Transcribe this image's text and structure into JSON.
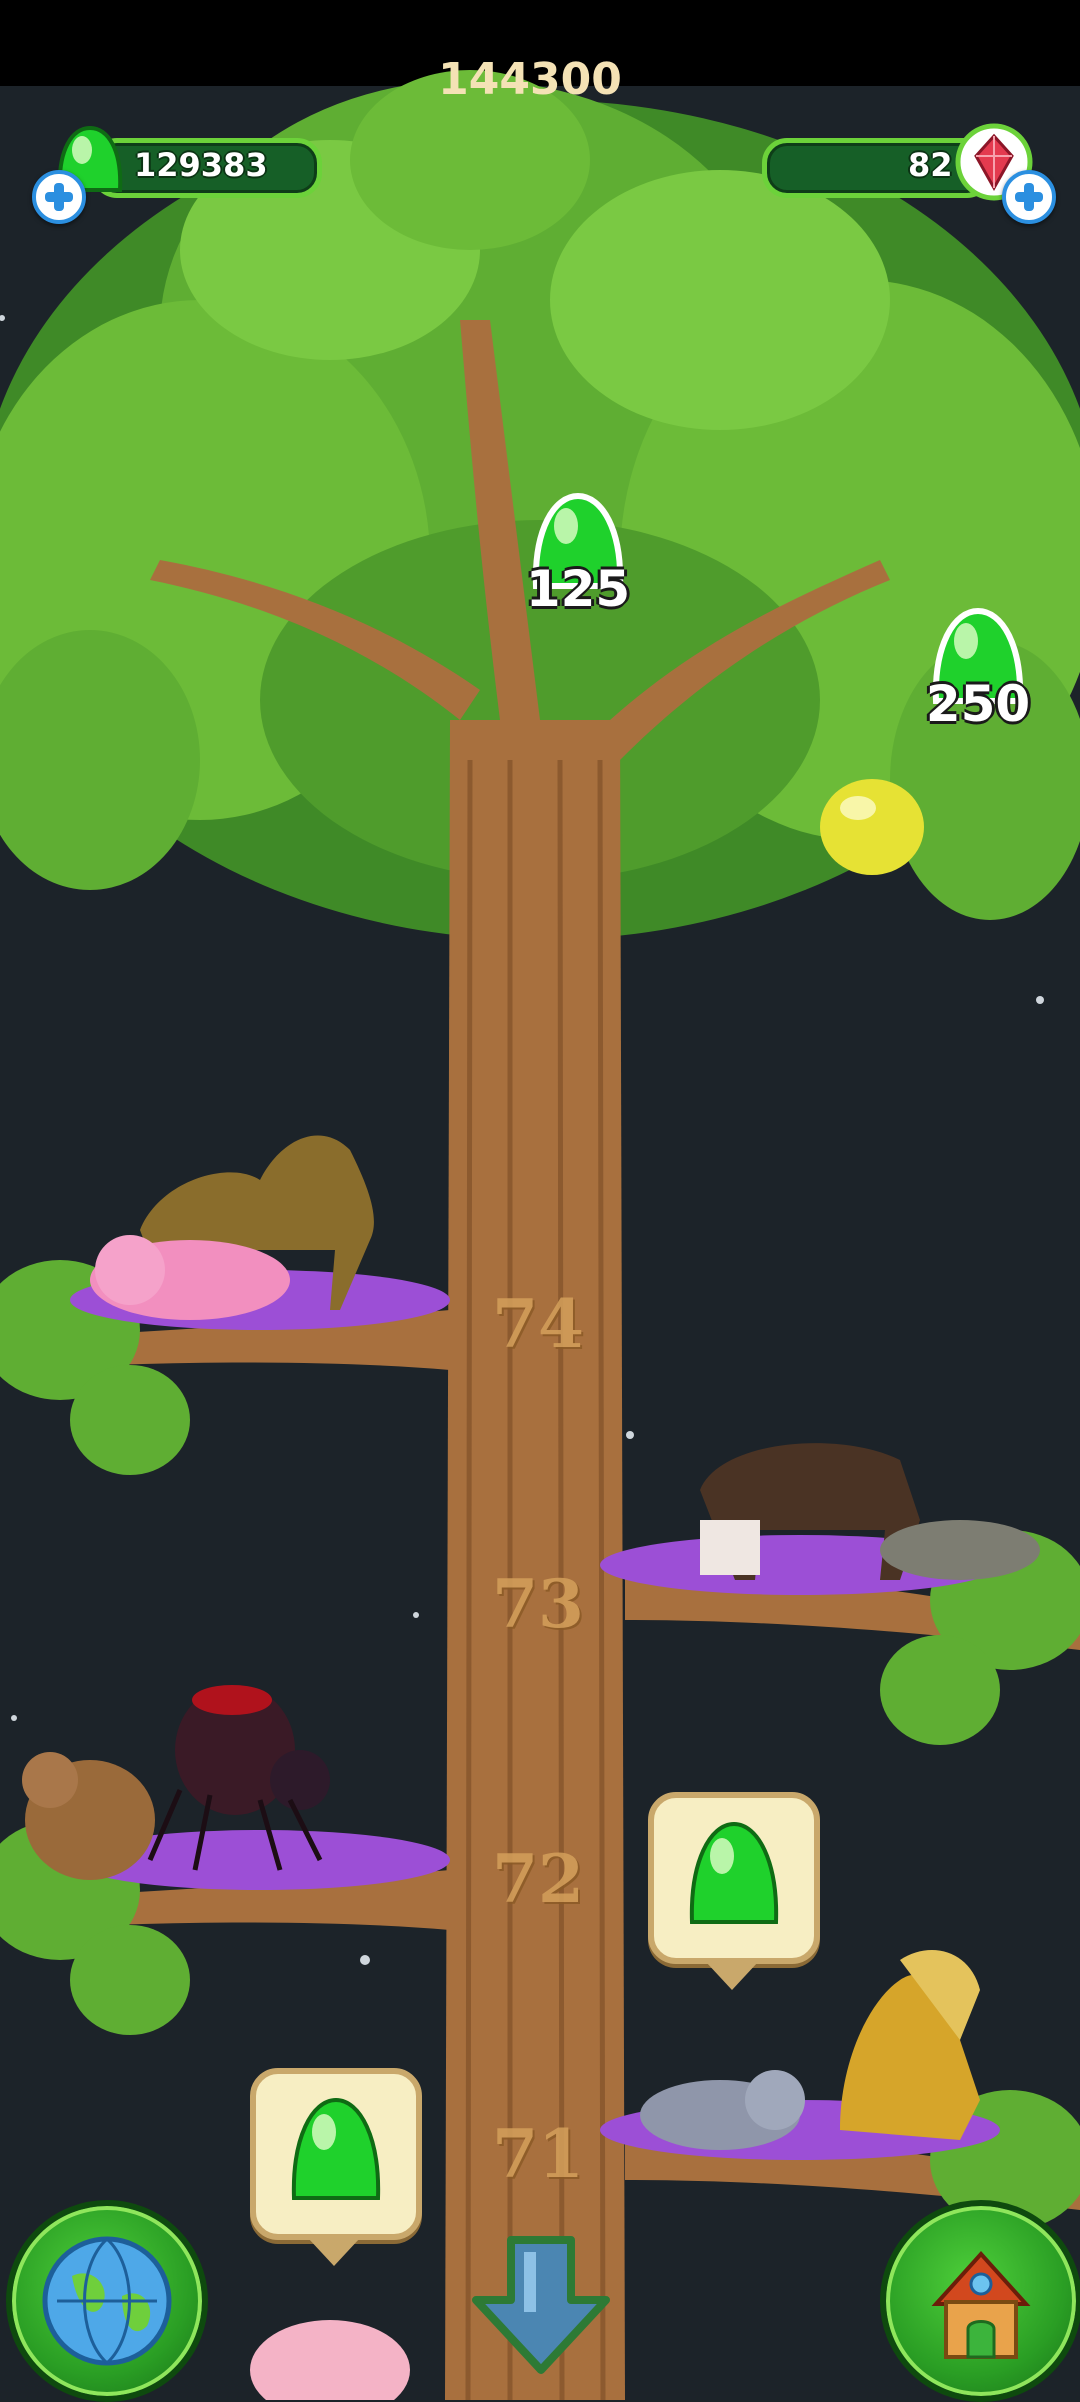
{
  "hud": {
    "top_goal": "144300",
    "jelly_count": "129383",
    "gem_count": "82",
    "jelly_icon": "green-jelly-icon",
    "gem_icon": "red-gem-icon"
  },
  "collectibles": [
    {
      "value": "125",
      "icon": "green-jelly-icon"
    },
    {
      "value": "250",
      "icon": "green-jelly-icon"
    }
  ],
  "floors": [
    {
      "label": "74"
    },
    {
      "label": "73"
    },
    {
      "label": "72"
    },
    {
      "label": "71"
    }
  ],
  "buttons": {
    "map": "globe-icon",
    "home": "house-icon",
    "scroll_down": "down-arrow-icon"
  },
  "colors": {
    "background": "#1c2329",
    "leaf": "#5fae33",
    "bark": "#a8703e",
    "jelly": "#1fd12c",
    "hud_bar": "#165f27",
    "gold": "#d4a05b"
  }
}
